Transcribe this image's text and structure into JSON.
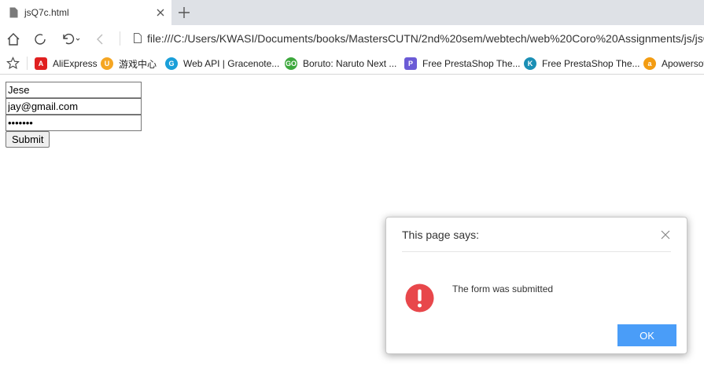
{
  "browser": {
    "tab": {
      "title": "jsQ7c.html"
    },
    "address": "file:///C:/Users/KWASI/Documents/books/MastersCUTN/2nd%20sem/webtech/web%20Coro%20Assignments/js/jsQ"
  },
  "bookmarks": [
    {
      "label": "AliExpress",
      "icon": "aliexpress-icon",
      "color": "#e02020"
    },
    {
      "label": "游戏中心",
      "icon": "game-center-icon",
      "color": "#f5a623"
    },
    {
      "label": "Web API | Gracenote...",
      "icon": "gracenote-icon",
      "color": "#1a9fd9"
    },
    {
      "label": "Boruto: Naruto Next ...",
      "icon": "gogoanime-icon",
      "color": "#3da83d"
    },
    {
      "label": "Free PrestaShop The...",
      "icon": "prestashop-purple-icon",
      "color": "#6b5bd6"
    },
    {
      "label": "Free PrestaShop The...",
      "icon": "prestashop-teal-icon",
      "color": "#1b8fb5"
    },
    {
      "label": "Apowersof",
      "icon": "apowersoft-icon",
      "color": "#f39c12"
    }
  ],
  "form": {
    "name_value": "Jese",
    "email_value": "jay@gmail.com",
    "password_value": "•••••••",
    "submit_label": "Submit"
  },
  "dialog": {
    "title": "This page says:",
    "message": "The form was submitted",
    "ok_label": "OK",
    "icon": "alert-icon",
    "icon_color": "#e8474b",
    "button_color": "#4a9df8"
  }
}
